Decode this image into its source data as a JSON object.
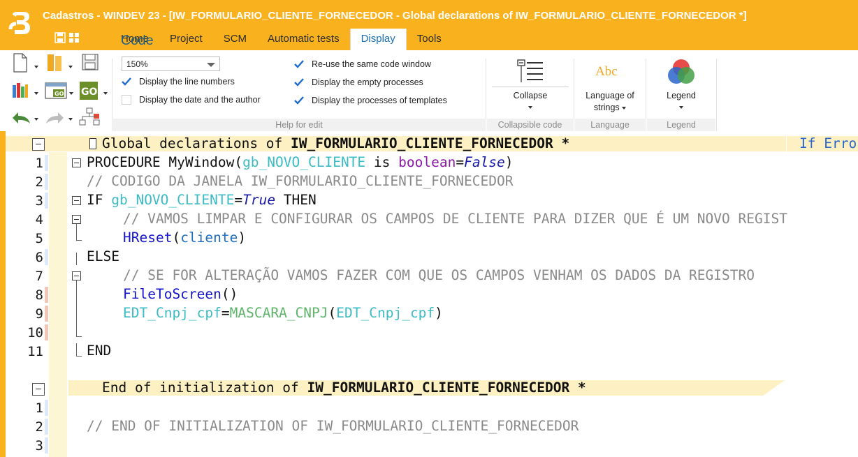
{
  "window": {
    "title": "Cadastros - WINDEV 23 - [IW_FORMULARIO_CLIENTE_FORNECEDOR - Global declarations of IW_FORMULARIO_CLIENTE_FORNECEDOR *]"
  },
  "tabs": [
    {
      "label": "Home"
    },
    {
      "label": "Project"
    },
    {
      "label": "SCM"
    },
    {
      "label": "Automatic tests"
    },
    {
      "label": "Code"
    },
    {
      "label": "Display",
      "active": true
    },
    {
      "label": "Tools"
    }
  ],
  "ribbon": {
    "zoom": "150%",
    "options": {
      "line_numbers": {
        "label": "Display the line numbers",
        "checked": true
      },
      "date_author": {
        "label": "Display the date and the author",
        "checked": false
      },
      "reuse_window": {
        "label": "Re-use the same code window",
        "checked": true
      },
      "empty_processes": {
        "label": "Display the empty processes",
        "checked": true
      },
      "template_processes": {
        "label": "Display the processes of templates",
        "checked": true
      }
    },
    "help_group": "Help for edit",
    "collapse": {
      "label": "Collapse",
      "group": "Collapsible code"
    },
    "language": {
      "label_line1": "Language of",
      "label_line2": "strings",
      "group": "Language",
      "icon_text": "Abc"
    },
    "legend": {
      "label": "Legend",
      "group": "Legend"
    }
  },
  "editor": {
    "truncated_right": "If Erro",
    "section1": {
      "title_prefix": "Global declarations of ",
      "title_name": "IW_FORMULARIO_CLIENTE_FORNECEDOR",
      "title_suffix": " *",
      "lines": [
        {
          "n": "1",
          "t1": "PROCEDURE MyWindow(",
          "t2": "gb_NOVO_CLIENTE",
          "t3": " is ",
          "t4": "boolean",
          "t5": "=",
          "t6": "False",
          "t7": ")"
        },
        {
          "n": "2",
          "text": "// CODIGO DA JANELA IW_FORMULARIO_CLIENTE_FORNECEDOR"
        },
        {
          "n": "3",
          "t1": "IF ",
          "t2": "gb_NOVO_CLIENTE",
          "t3": "=",
          "t4": "True",
          "t5": " THEN"
        },
        {
          "n": "4",
          "text": "// VAMOS LIMPAR E CONFIGURAR OS CAMPOS DE CLIENTE PARA DIZER QUE É UM NOVO REGIST"
        },
        {
          "n": "5",
          "t1": "HReset",
          "t2": "(",
          "t3": "cliente",
          "t4": ")"
        },
        {
          "n": "6",
          "text": "ELSE"
        },
        {
          "n": "7",
          "text": "// SE FOR ALTERAÇÃO VAMOS FAZER COM QUE OS CAMPOS VENHAM OS DADOS DA REGISTRO"
        },
        {
          "n": "8",
          "t1": "FileToScreen",
          "t2": "()"
        },
        {
          "n": "9",
          "t1": "EDT_Cnpj_cpf",
          "t2": "=",
          "t3": "MASCARA_CNPJ",
          "t4": "(",
          "t5": "EDT_Cnpj_cpf",
          "t6": ")"
        },
        {
          "n": "10",
          "text": ""
        },
        {
          "n": "11",
          "text": "END"
        }
      ]
    },
    "section2": {
      "title_prefix": "End of initialization of ",
      "title_name": "IW_FORMULARIO_CLIENTE_FORNECEDOR",
      "title_suffix": " *",
      "lines": [
        {
          "n": "1",
          "text": ""
        },
        {
          "n": "2",
          "text": "// END OF INITIALIZATION OF IW_FORMULARIO_CLIENTE_FORNECEDOR"
        },
        {
          "n": "3",
          "text": ""
        }
      ]
    }
  },
  "colors": {
    "accent": "#f9b21d",
    "keyword_var": "#3bbcc4",
    "type": "#8b19a8",
    "comment": "#8a8a8a",
    "function": "#1414cc"
  }
}
